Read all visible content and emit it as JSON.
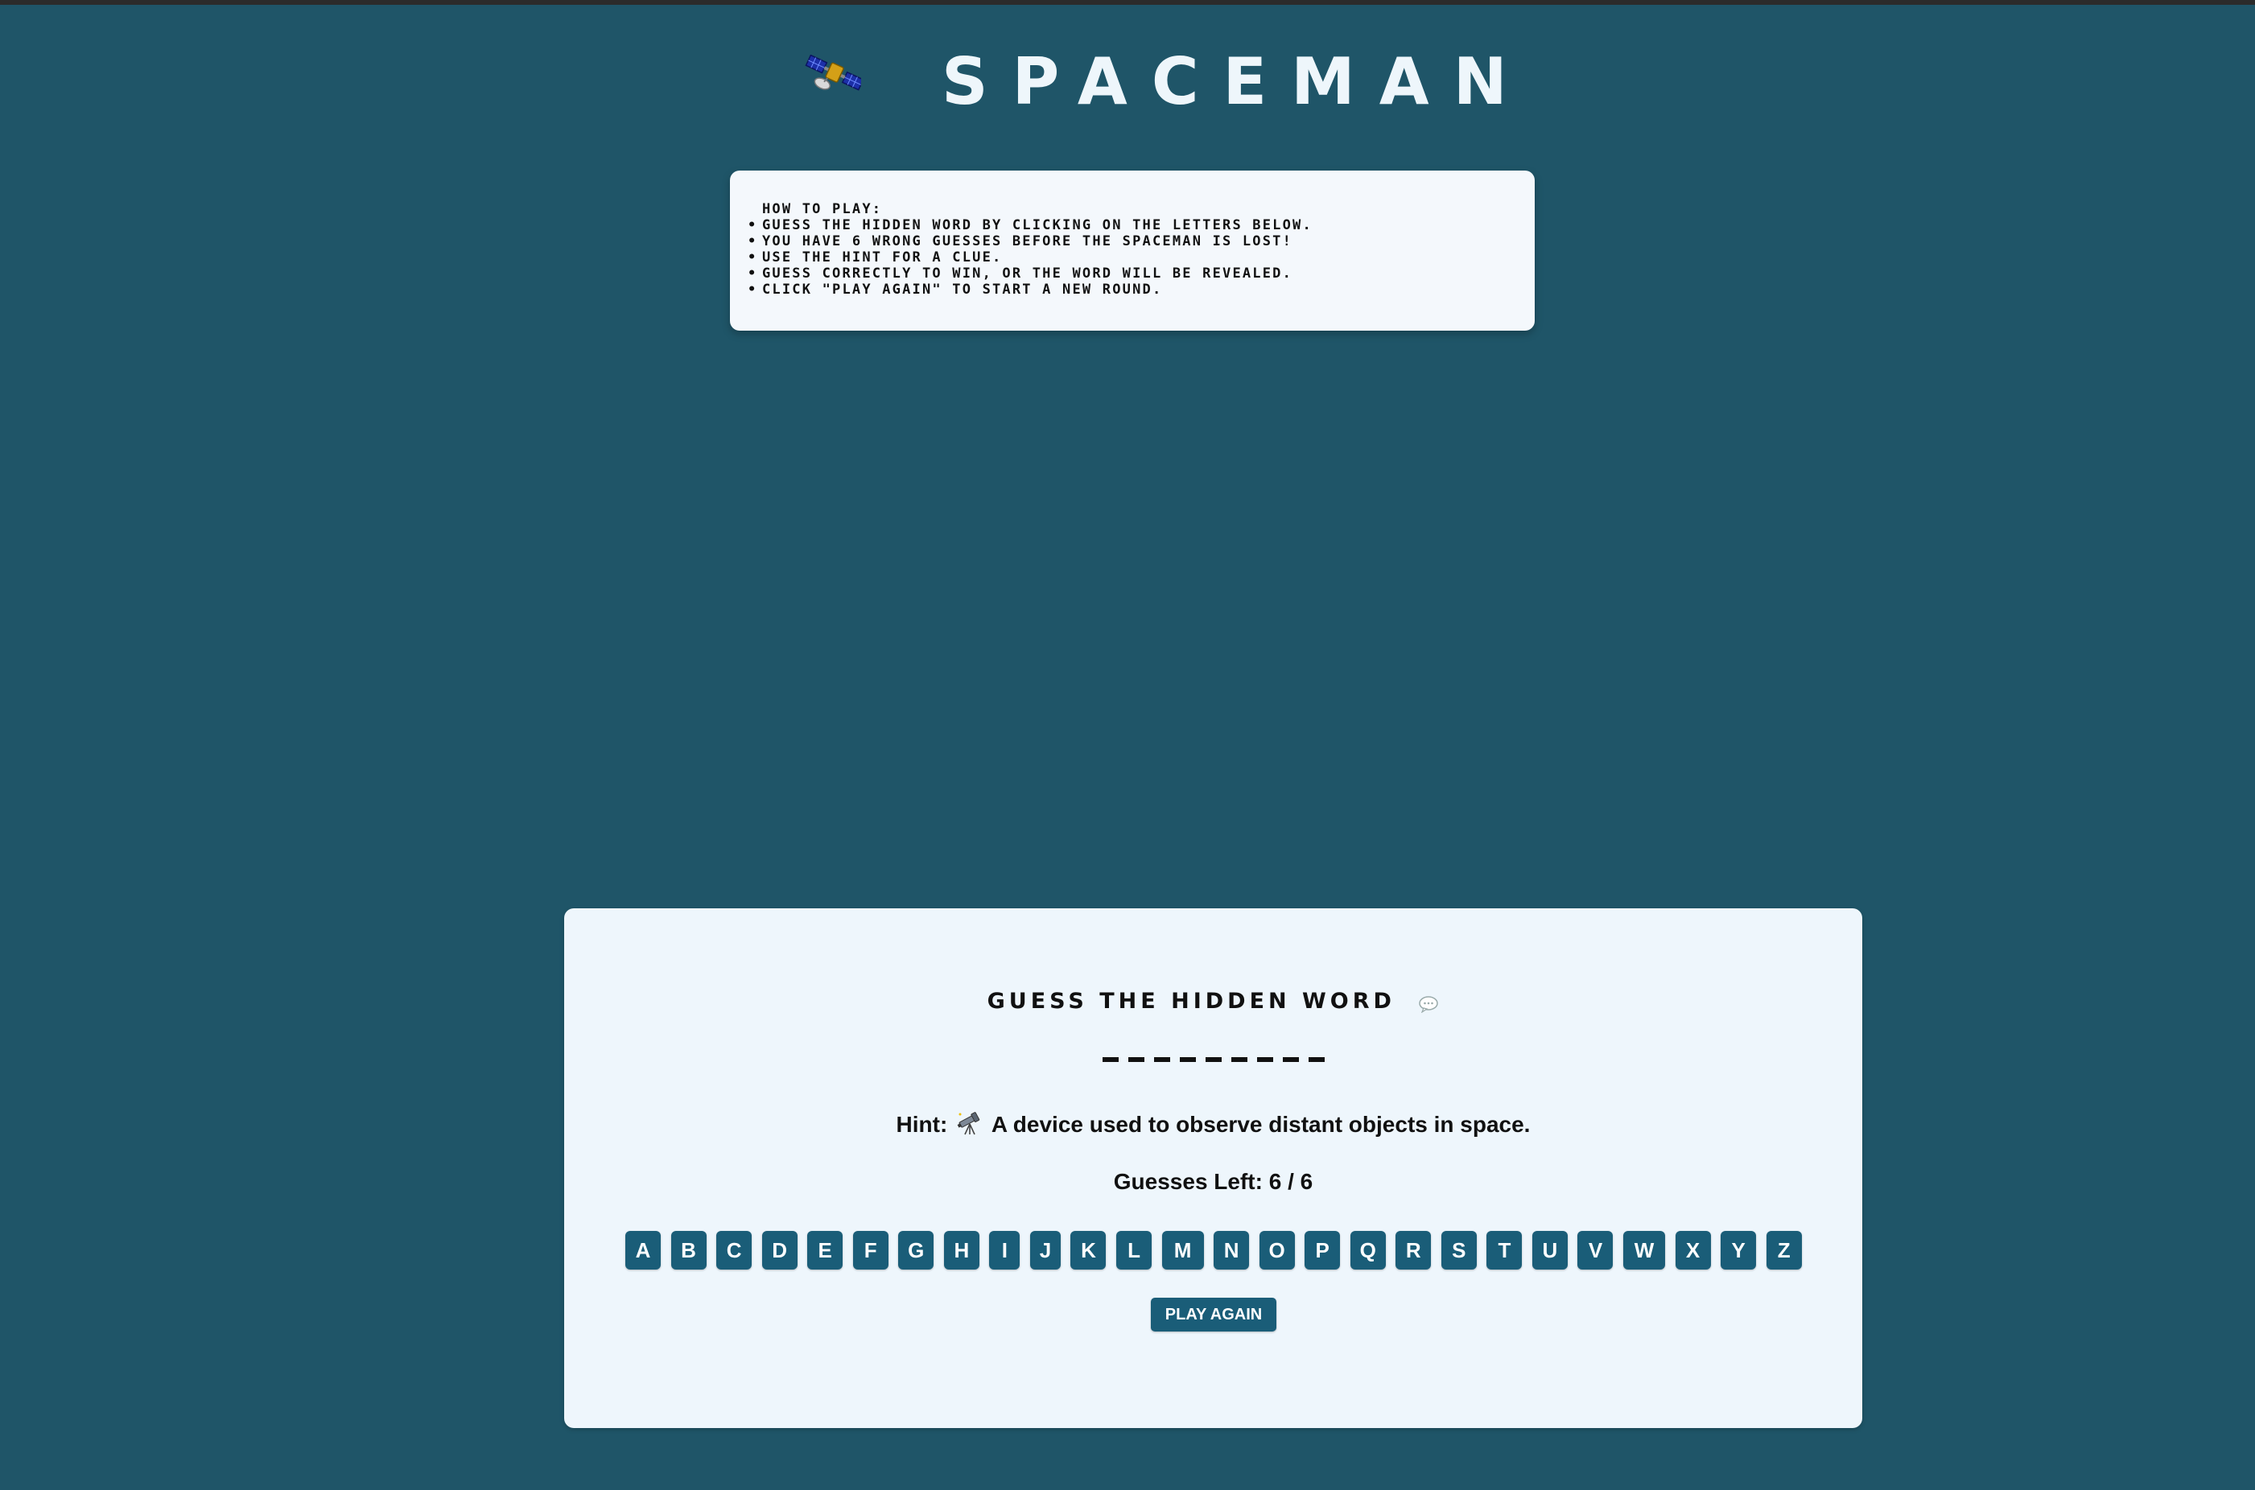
{
  "header": {
    "title": "SPACEMAN",
    "icon": "satellite-icon"
  },
  "howto": {
    "lines": [
      {
        "bullet": "",
        "text": "How to Play:"
      },
      {
        "bullet": "•",
        "text": "Guess the hidden word by clicking on the letters below."
      },
      {
        "bullet": "•",
        "text": "You have 6 wrong guesses before the spaceman is lost!"
      },
      {
        "bullet": "•",
        "text": "Use the hint for a clue."
      },
      {
        "bullet": "•",
        "text": "Guess correctly to win, or the word will be revealed."
      },
      {
        "bullet": "•",
        "text": "Click \"Play Again\" to start a new round."
      }
    ]
  },
  "game": {
    "title": "GUESS THE HIDDEN WORD",
    "title_icon": "speech-bubble-icon",
    "word_length": 9,
    "hint_label": "Hint:",
    "hint_icon": "telescope-icon",
    "hint_text": "A device used to observe distant objects in space.",
    "guesses_left": "Guesses Left: 6 / 6",
    "letters": [
      "A",
      "B",
      "C",
      "D",
      "E",
      "F",
      "G",
      "H",
      "I",
      "J",
      "K",
      "L",
      "M",
      "N",
      "O",
      "P",
      "Q",
      "R",
      "S",
      "T",
      "U",
      "V",
      "W",
      "X",
      "Y",
      "Z"
    ],
    "play_again_label": "PLAY AGAIN"
  },
  "colors": {
    "background": "#1f5568",
    "button": "#1a5d78",
    "panel": "#eef6fc"
  }
}
